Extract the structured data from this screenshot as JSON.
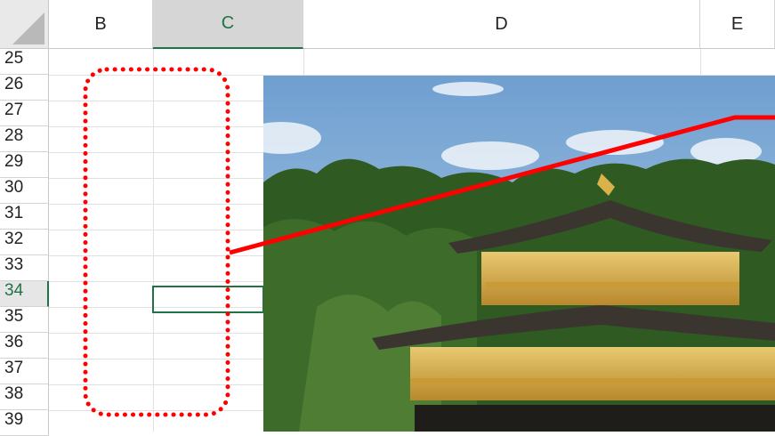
{
  "columns": [
    {
      "label": "B"
    },
    {
      "label": "C"
    },
    {
      "label": "D"
    },
    {
      "label": "E"
    }
  ],
  "rows": [
    "25",
    "26",
    "27",
    "28",
    "29",
    "30",
    "31",
    "32",
    "33",
    "34",
    "35",
    "36",
    "37",
    "38",
    "39"
  ],
  "selected_cell": "C34",
  "colors": {
    "selection": "#217346",
    "annotation": "#ff0000"
  }
}
